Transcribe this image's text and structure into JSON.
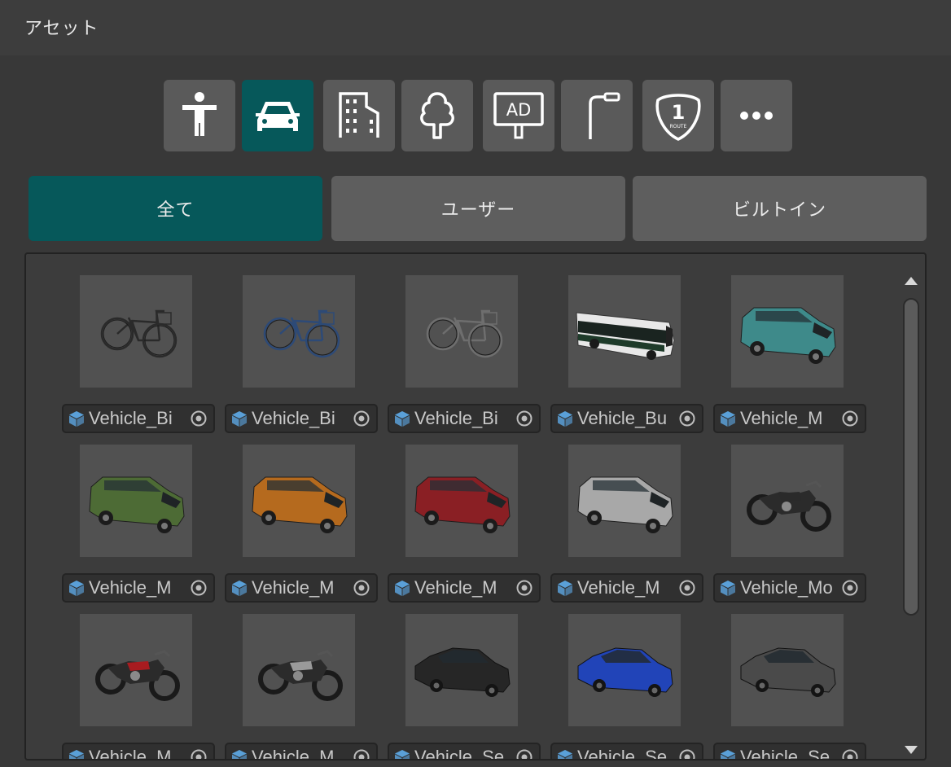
{
  "header": {
    "title": "アセット"
  },
  "categories": [
    {
      "name": "person",
      "icon": "person-icon",
      "active": false
    },
    {
      "name": "vehicle",
      "icon": "car-icon",
      "active": true
    },
    {
      "name": "building",
      "icon": "building-icon",
      "active": false
    },
    {
      "name": "tree",
      "icon": "tree-icon",
      "active": false
    },
    {
      "name": "billboard",
      "icon": "billboard-icon",
      "active": false
    },
    {
      "name": "streetlight",
      "icon": "streetlight-icon",
      "active": false
    },
    {
      "name": "route-sign",
      "icon": "route-sign-icon",
      "active": false
    },
    {
      "name": "more",
      "icon": "more-icon",
      "active": false
    }
  ],
  "category_texts": {
    "billboard": "AD",
    "route_number": "1",
    "route_text": "ROUTE"
  },
  "filters": {
    "all": "全て",
    "user": "ユーザー",
    "builtin": "ビルトイン",
    "active": "all"
  },
  "assets": [
    {
      "label": "Vehicle_Bi",
      "kind": "bicycle",
      "color": "#2a2a2a"
    },
    {
      "label": "Vehicle_Bi",
      "kind": "bicycle",
      "color": "#2d4a77"
    },
    {
      "label": "Vehicle_Bi",
      "kind": "bicycle",
      "color": "#6e6e6e"
    },
    {
      "label": "Vehicle_Bu",
      "kind": "bus",
      "color": "#1e3b2a"
    },
    {
      "label": "Vehicle_M",
      "kind": "van",
      "color": "#3e8a8a"
    },
    {
      "label": "Vehicle_M",
      "kind": "van",
      "color": "#4d6b35"
    },
    {
      "label": "Vehicle_M",
      "kind": "van",
      "color": "#b56a1e"
    },
    {
      "label": "Vehicle_M",
      "kind": "van",
      "color": "#8a1f24"
    },
    {
      "label": "Vehicle_M",
      "kind": "van",
      "color": "#a8a8a8"
    },
    {
      "label": "Vehicle_Mo",
      "kind": "motorcycle",
      "color": "#2a2a2a"
    },
    {
      "label": "Vehicle_M",
      "kind": "motorcycle",
      "color": "#a81c20"
    },
    {
      "label": "Vehicle_M",
      "kind": "motorcycle",
      "color": "#9a9a9a"
    },
    {
      "label": "Vehicle_Se",
      "kind": "sedan",
      "color": "#262626"
    },
    {
      "label": "Vehicle_Se",
      "kind": "sedan",
      "color": "#2144b8"
    },
    {
      "label": "Vehicle_Se",
      "kind": "sedan",
      "color": "#4a4a4a"
    }
  ],
  "colors": {
    "accent": "#06585a",
    "button": "#5a5a5a",
    "cube": "#5aa0d8"
  }
}
